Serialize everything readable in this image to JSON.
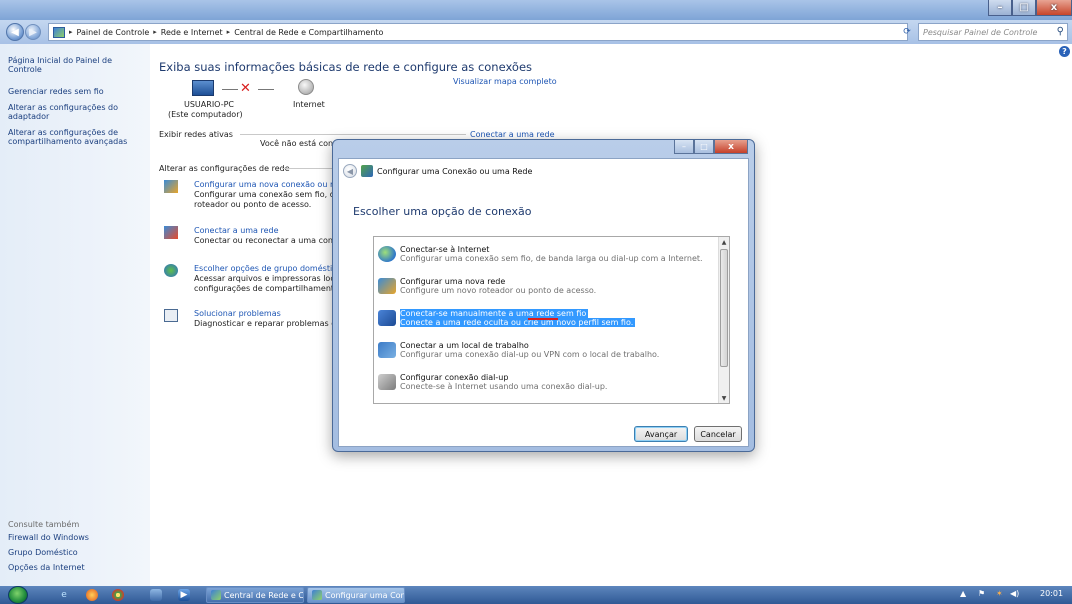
{
  "window": {
    "buttons": {
      "minimize": "–",
      "maximize": "□",
      "close": "x"
    }
  },
  "nav": {
    "breadcrumbs": [
      "Painel de Controle",
      "Rede e Internet",
      "Central de Rede e Compartilhamento"
    ],
    "search_placeholder": "Pesquisar Painel de Controle"
  },
  "sidebar": {
    "links": [
      "Página Inicial do Painel de Controle",
      "Gerenciar redes sem fio",
      "Alterar as configurações do adaptador",
      "Alterar as configurações de compartilhamento avançadas"
    ],
    "see_also_title": "Consulte também",
    "see_also": [
      "Firewall do Windows",
      "Grupo Doméstico",
      "Opções da Internet"
    ]
  },
  "main": {
    "heading": "Exiba suas informações básicas de rede e configure as conexões",
    "view_map_link": "Visualizar mapa completo",
    "pc_name": "USUARIO-PC",
    "pc_sub": "(Este computador)",
    "internet_label": "Internet",
    "active_networks_label": "Exibir redes ativas",
    "connect_link": "Conectar a uma rede",
    "not_connected": "Você não está conectado a nenhuma rede",
    "change_settings_label": "Alterar as configurações de rede",
    "tasks": [
      {
        "title": "Configurar uma nova conexão ou rede",
        "desc1": "Configurar uma conexão sem fio, de ba",
        "desc2": "roteador ou ponto de acesso."
      },
      {
        "title": "Conectar a uma rede",
        "desc1": "Conectar ou reconectar a uma conexão",
        "desc2": ""
      },
      {
        "title": "Escolher opções de grupo doméstico e",
        "desc1": "Acessar arquivos e impressoras localiza",
        "desc2": "configurações de compartilhamento."
      },
      {
        "title": "Solucionar problemas",
        "desc1": "Diagnosticar e reparar problemas de red",
        "desc2": ""
      }
    ]
  },
  "dialog": {
    "title": "Configurar uma Conexão ou uma Rede",
    "subtitle": "Escolher uma opção de conexão",
    "options": [
      {
        "title": "Conectar-se à Internet",
        "desc": "Configurar uma conexão sem fio, de banda larga ou dial-up com a Internet.",
        "selected": false
      },
      {
        "title": "Configurar uma nova rede",
        "desc": "Configure um novo roteador ou ponto de acesso.",
        "selected": false
      },
      {
        "title": "Conectar-se manualmente a uma rede sem fio",
        "desc": "Conecte a uma rede oculta ou crie um novo perfil sem fio.",
        "selected": true
      },
      {
        "title": "Conectar a um local de trabalho",
        "desc": "Configurar uma conexão dial-up ou VPN com o local de trabalho.",
        "selected": false
      },
      {
        "title": "Configurar conexão dial-up",
        "desc": "Conecte-se à Internet usando uma conexão dial-up.",
        "selected": false
      }
    ],
    "next_button": "Avançar",
    "cancel_button": "Cancelar"
  },
  "taskbar": {
    "tasks": [
      "Central de Rede e Co...",
      "Configurar uma Con..."
    ],
    "clock": "20:01"
  }
}
